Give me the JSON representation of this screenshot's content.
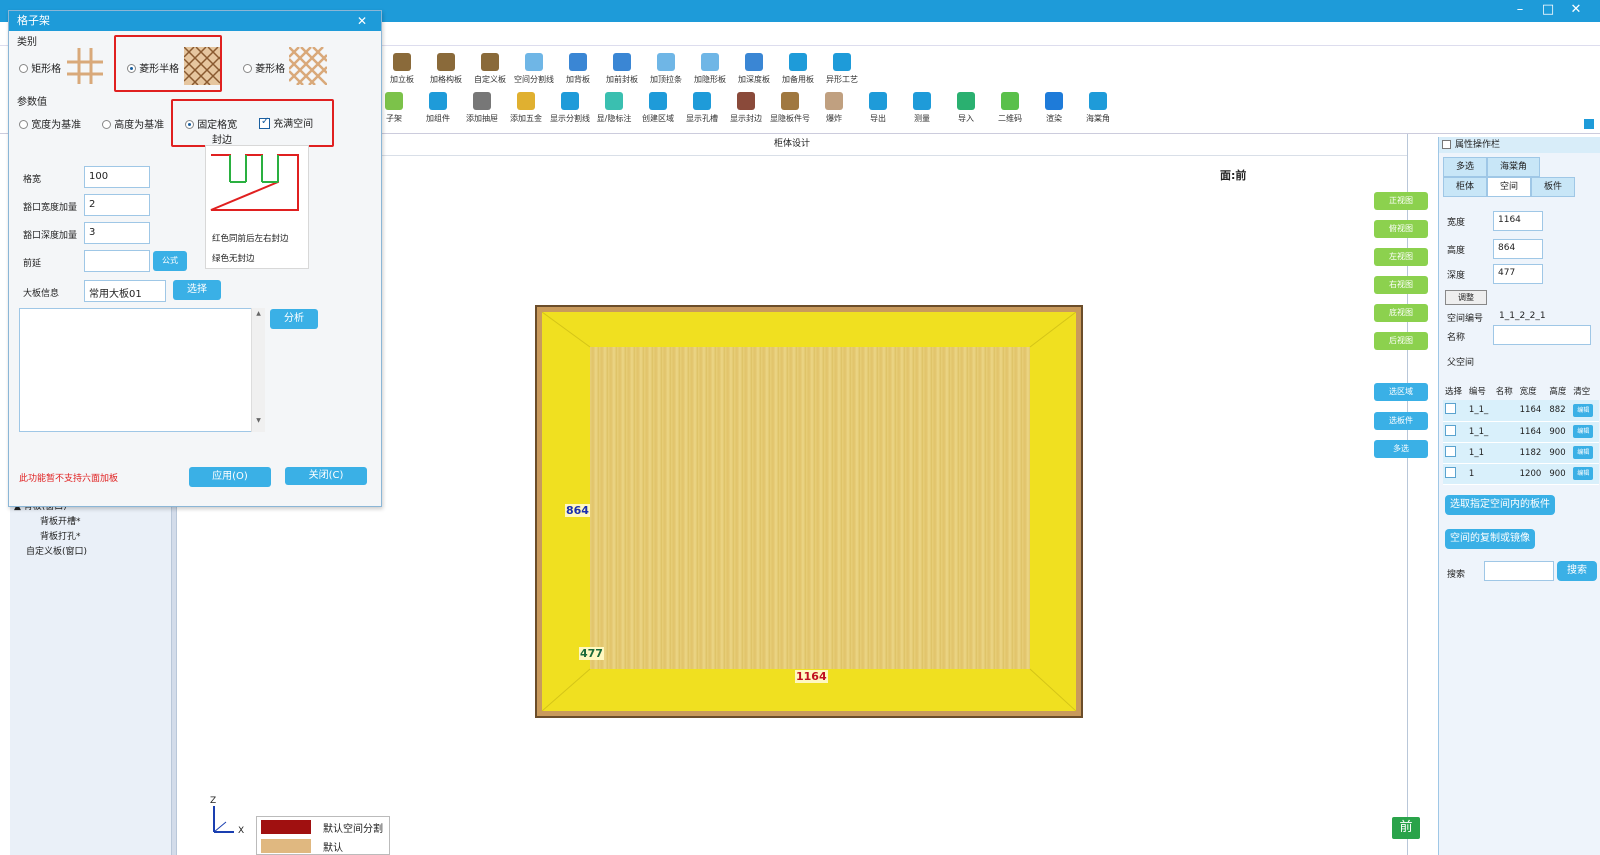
{
  "window": {
    "minimize": "–",
    "maximize": "□",
    "close": "✕"
  },
  "toolbar": {
    "row1": [
      {
        "label": "加立板",
        "icon": "vertical-board-icon",
        "color": "#8a6a3a"
      },
      {
        "label": "加格构板",
        "icon": "grid-board-icon",
        "color": "#8a6a3a"
      },
      {
        "label": "自定义板",
        "icon": "custom-board-icon",
        "color": "#8a6a3a"
      },
      {
        "label": "空间分割线",
        "icon": "space-split-icon",
        "color": "#6fb6e6"
      },
      {
        "label": "加背板",
        "icon": "back-board-icon",
        "color": "#3a86d4"
      },
      {
        "label": "加前封板",
        "icon": "front-seal-icon",
        "color": "#3a86d4"
      },
      {
        "label": "加顶拉条",
        "icon": "top-strip-icon",
        "color": "#6fb6e6"
      },
      {
        "label": "加隐形板",
        "icon": "hidden-board-icon",
        "color": "#6fb6e6"
      },
      {
        "label": "加深度板",
        "icon": "depth-board-icon",
        "color": "#3a86d4"
      },
      {
        "label": "加备用板",
        "icon": "spare-board-icon",
        "color": "#1e9bd9"
      },
      {
        "label": "异形工艺",
        "icon": "shape-process-icon",
        "color": "#1e9bd9"
      }
    ],
    "row2": [
      {
        "label": "子架",
        "icon": "sub-frame-icon",
        "color": "#7cc24a"
      },
      {
        "label": "加组件",
        "icon": "add-component-icon",
        "color": "#1e9bd9"
      },
      {
        "label": "添加抽屉",
        "icon": "add-drawer-icon",
        "color": "#777777"
      },
      {
        "label": "添加五金",
        "icon": "add-hardware-icon",
        "color": "#e0b030"
      },
      {
        "label": "显示分割线",
        "icon": "show-split-icon",
        "color": "#1e9bd9"
      },
      {
        "label": "显/隐标注",
        "icon": "toggle-label-icon",
        "color": "#3abfb0"
      },
      {
        "label": "创建区域",
        "icon": "create-area-icon",
        "color": "#1e9bd9"
      },
      {
        "label": "显示孔槽",
        "icon": "show-holes-icon",
        "color": "#1e9bd9"
      },
      {
        "label": "显示封边",
        "icon": "show-edge-icon",
        "color": "#8a4a3a"
      },
      {
        "label": "显隐板件号",
        "icon": "toggle-part-no-icon",
        "color": "#a07840"
      },
      {
        "label": "爆炸",
        "icon": "explode-icon",
        "color": "#c0a080"
      },
      {
        "label": "导出",
        "icon": "export-icon",
        "color": "#1e9bd9"
      },
      {
        "label": "测量",
        "icon": "measure-icon",
        "color": "#1e9bd9"
      },
      {
        "label": "导入",
        "icon": "import-icon",
        "color": "#2ab070"
      },
      {
        "label": "二维码",
        "icon": "qr-code-icon",
        "color": "#5ac04a"
      },
      {
        "label": "渲染",
        "icon": "render-icon",
        "color": "#1e7bd9"
      },
      {
        "label": "海棠角",
        "icon": "begonia-corner-icon",
        "color": "#1e9bd9"
      }
    ]
  },
  "tree": {
    "items": [
      "背板(窗口)",
      "背板开槽*",
      "背板打孔*",
      "自定义板(窗口)"
    ]
  },
  "center": {
    "title": "柜体设计",
    "face": "面:前",
    "view_buttons": [
      "正视图",
      "俯视图",
      "左视图",
      "右视图",
      "底视图",
      "后视图"
    ],
    "select_buttons": [
      "选区域",
      "选板件",
      "多选"
    ],
    "dims": {
      "height": "864",
      "depth": "477",
      "width": "1164"
    },
    "axis": {
      "z": "Z",
      "x": "X"
    },
    "legend": [
      {
        "label": "默认空间分割",
        "color": "#a01010"
      },
      {
        "label": "默认",
        "color": "#e0b880"
      }
    ],
    "view_cube": "前"
  },
  "right": {
    "title": "属性操作栏",
    "tabs_top": [
      "多选",
      "海棠角"
    ],
    "tabs": [
      "柜体",
      "空间",
      "板件"
    ],
    "active_tab": "空间",
    "width_label": "宽度",
    "width": "1164",
    "height_label": "高度",
    "height": "864",
    "depth_label": "深度",
    "depth": "477",
    "adjust_btn": "调整",
    "space_no_label": "空间编号",
    "space_no": "1_1_2_2_1",
    "name_label": "名称",
    "name": "",
    "parent_label": "父空间",
    "table_headers": [
      "选择",
      "编号",
      "名称",
      "宽度",
      "高度",
      "清空"
    ],
    "rows": [
      {
        "no": "1_1_",
        "name": "",
        "w": "1164",
        "h": "882",
        "btn": "编辑"
      },
      {
        "no": "1_1_",
        "name": "",
        "w": "1164",
        "h": "900",
        "btn": "编辑"
      },
      {
        "no": "1_1",
        "name": "",
        "w": "1182",
        "h": "900",
        "btn": "编辑"
      },
      {
        "no": "1",
        "name": "",
        "w": "1200",
        "h": "900",
        "btn": "编辑"
      }
    ],
    "select_inner_btn": "选取指定空间内的板件",
    "copy_mirror_btn": "空间的复制或镜像",
    "search_label": "搜索",
    "search_value": "",
    "search_btn": "搜索"
  },
  "dialog": {
    "title": "格子架",
    "close": "✕",
    "category_label": "类别",
    "categories": [
      "矩形格",
      "菱形半格",
      "菱形格"
    ],
    "category_selected": 1,
    "params_label": "参数值",
    "base_options": [
      "宽度为基准",
      "高度为基准",
      "固定格宽"
    ],
    "base_selected": 2,
    "fill_space_label": "充满空间",
    "fill_space_checked": true,
    "edge_label": "封边",
    "edge_note_1": "红色同前后左右封边",
    "edge_note_2": "绿色无封边",
    "fields": [
      {
        "label": "格宽",
        "value": "100"
      },
      {
        "label": "豁口宽度加量",
        "value": "2"
      },
      {
        "label": "豁口深度加量",
        "value": "3"
      },
      {
        "label": "前延",
        "value": ""
      },
      {
        "label": "大板信息",
        "value": "常用大板01"
      }
    ],
    "formula_btn": "公式",
    "select_btn": "选择",
    "analyze_btn": "分析",
    "warning": "此功能暂不支持六面加板",
    "apply_btn": "应用(O)",
    "close_btn": "关闭(C)",
    "colors": {
      "warning": "#e02020",
      "highlight": "#e02020"
    }
  }
}
